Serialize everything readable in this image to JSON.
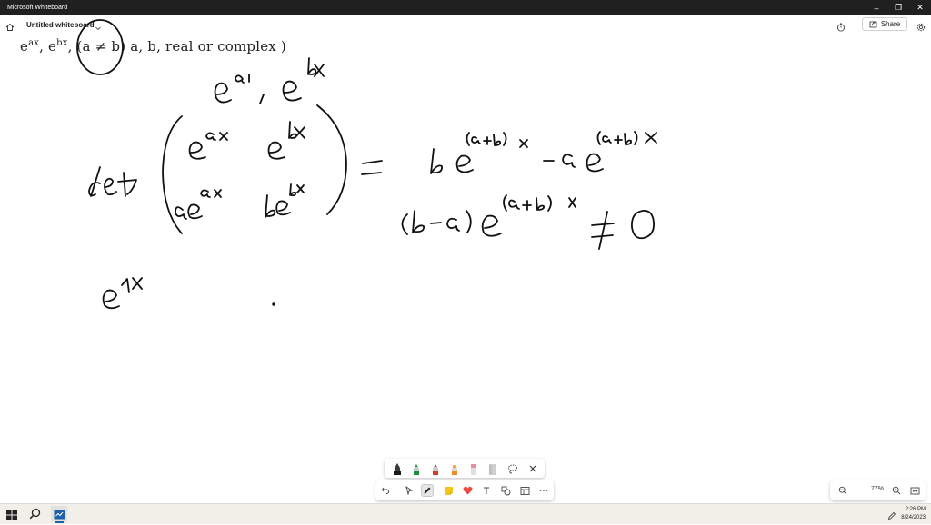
{
  "window": {
    "app_title": "Microsoft Whiteboard",
    "controls": [
      "–",
      "❐",
      "✕"
    ]
  },
  "toolbar": {
    "board_title": "Untitled whiteboard",
    "share_label": "Share"
  },
  "canvas": {
    "typed_text": "e^{ax}, e^{bx}, (a ≠ b) a, b, real or complex )",
    "typed_parts": {
      "t1": "e",
      "s1": "ax",
      "t2": ", e",
      "s2": "bx",
      "t3": ", (a ≠ b) a, b,  real or complex )"
    }
  },
  "zoom": {
    "level": "77%"
  },
  "taskbar": {
    "time": "2:26 PM",
    "date": "8/24/2023"
  },
  "icons": {
    "titlebar": [
      "minimize-icon",
      "restore-icon",
      "close-icon"
    ],
    "toolbar": [
      "home-icon",
      "chevron-down-icon",
      "timer-icon",
      "share-icon",
      "gear-icon"
    ],
    "pens": [
      "black-pen-icon",
      "green-pen-icon",
      "red-pen-icon",
      "orange-highlighter-icon",
      "eraser-icon",
      "ruler-icon",
      "lasso-icon",
      "close-icon"
    ],
    "tools": [
      "undo-icon",
      "select-icon",
      "pen-icon",
      "sticky-note-icon",
      "reaction-icon",
      "text-icon",
      "shapes-icon",
      "template-icon",
      "more-icon"
    ],
    "zoom": [
      "zoom-out-icon",
      "zoom-in-icon",
      "fit-screen-icon"
    ],
    "taskbar": [
      "windows-start-icon",
      "search-icon",
      "whiteboard-app-icon",
      "pen-settings-icon"
    ]
  }
}
